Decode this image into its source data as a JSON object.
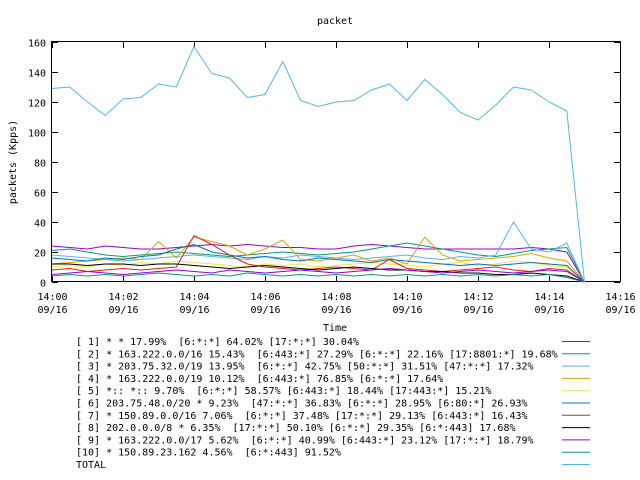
{
  "chart_data": {
    "type": "line",
    "title": "packet",
    "xlabel": "Time",
    "ylabel": "packets (Kpps)",
    "ylim": [
      0,
      160
    ],
    "xlim": [
      "14:00",
      "14:16"
    ],
    "grid": false,
    "legend_placement": "bottom",
    "y_ticks": [
      0,
      20,
      40,
      60,
      80,
      100,
      120,
      140,
      160
    ],
    "x_ticks": [
      {
        "time": "14:00",
        "date": "09/16"
      },
      {
        "time": "14:02",
        "date": "09/16"
      },
      {
        "time": "14:04",
        "date": "09/16"
      },
      {
        "time": "14:06",
        "date": "09/16"
      },
      {
        "time": "14:08",
        "date": "09/16"
      },
      {
        "time": "14:10",
        "date": "09/16"
      },
      {
        "time": "14:12",
        "date": "09/16"
      },
      {
        "time": "14:14",
        "date": "09/16"
      },
      {
        "time": "14:16",
        "date": "09/16"
      }
    ],
    "x": [
      "14:00:00",
      "14:00:30",
      "14:01:00",
      "14:01:30",
      "14:02:00",
      "14:02:30",
      "14:03:00",
      "14:03:30",
      "14:04:00",
      "14:04:30",
      "14:05:00",
      "14:05:30",
      "14:06:00",
      "14:06:30",
      "14:07:00",
      "14:07:30",
      "14:08:00",
      "14:08:30",
      "14:09:00",
      "14:09:30",
      "14:10:00",
      "14:10:30",
      "14:11:00",
      "14:11:30",
      "14:12:00",
      "14:12:30",
      "14:13:00",
      "14:13:30",
      "14:14:00",
      "14:14:30",
      "14:15:00"
    ],
    "series": [
      {
        "name": "[ 1] * * 17.99%  [6:*:*] 64.02% [17:*:*] 30.04%",
        "color": "#9400d3",
        "values": [
          24,
          23,
          22,
          24,
          23,
          22,
          22,
          23,
          24,
          25,
          24,
          25,
          24,
          23,
          23,
          22,
          22,
          24,
          25,
          24,
          23,
          22,
          22,
          22,
          22,
          22,
          22,
          23,
          22,
          20,
          0
        ]
      },
      {
        "name": "[ 2] * 163.222.0.0/16 15.43%  [6:443:*] 27.29% [6:*:*] 22.16% [17:8801:*] 19.68%",
        "color": "#009e73",
        "values": [
          21,
          22,
          20,
          18,
          17,
          18,
          19,
          20,
          19,
          18,
          17,
          18,
          19,
          20,
          19,
          18,
          19,
          20,
          22,
          24,
          26,
          24,
          22,
          20,
          18,
          17,
          19,
          21,
          22,
          23,
          0
        ]
      },
      {
        "name": "[ 3] * 203.75.32.0/19 13.95%  [6:*:*] 42.75% [50:*:*] 31.51% [47:*:*] 17.32%",
        "color": "#56b4e9",
        "values": [
          18,
          17,
          16,
          15,
          14,
          15,
          16,
          17,
          18,
          17,
          16,
          15,
          17,
          16,
          18,
          17,
          16,
          15,
          16,
          17,
          18,
          16,
          15,
          17,
          16,
          18,
          40,
          22,
          20,
          26,
          0
        ]
      },
      {
        "name": "[ 4] * 163.222.0.0/19 10.12%  [6:443:*] 76.85% [6:*:*] 17.64%",
        "color": "#e69f00",
        "values": [
          12,
          13,
          14,
          15,
          16,
          15,
          27,
          16,
          30,
          27,
          24,
          18,
          22,
          28,
          15,
          14,
          16,
          18,
          14,
          16,
          12,
          30,
          18,
          14,
          15,
          16,
          17,
          19,
          16,
          14,
          0
        ]
      },
      {
        "name": "[ 5] *:: *:: 9.70%  [6:*:*] 58.57% [6:443:*] 18.44% [17:443:*] 15.21%",
        "color": "#f0e442",
        "values": [
          10,
          11,
          10,
          12,
          11,
          13,
          12,
          14,
          13,
          12,
          11,
          10,
          12,
          11,
          12,
          10,
          11,
          12,
          13,
          12,
          11,
          10,
          12,
          13,
          11,
          12,
          14,
          13,
          11,
          10,
          0
        ]
      },
      {
        "name": "[ 6] 203.75.48.0/20 * 9.23%  [47:*:*] 36.83% [6:*:*] 28.95% [6:80:*] 26.93%",
        "color": "#0072b2",
        "values": [
          16,
          15,
          14,
          16,
          15,
          17,
          18,
          22,
          25,
          20,
          18,
          16,
          17,
          15,
          14,
          16,
          15,
          14,
          13,
          15,
          14,
          13,
          12,
          11,
          12,
          11,
          12,
          13,
          12,
          11,
          0
        ]
      },
      {
        "name": "[ 7] * 150.89.0.0/16 7.06%  [6:*:*] 37.48% [17:*:*] 29.13% [6:443:*] 16.43%",
        "color": "#e51e10",
        "values": [
          8,
          9,
          7,
          8,
          9,
          8,
          9,
          10,
          31,
          25,
          18,
          12,
          10,
          9,
          8,
          9,
          10,
          9,
          8,
          15,
          9,
          8,
          7,
          8,
          9,
          10,
          8,
          7,
          9,
          8,
          0
        ]
      },
      {
        "name": "[ 8] 202.0.0.0/8 * 6.35%  [17:*:*] 50.10% [6:*:*] 29.35% [6:*:443] 17.68%",
        "color": "#000000",
        "values": [
          12,
          12,
          11,
          12,
          12,
          11,
          12,
          12,
          11,
          10,
          9,
          10,
          11,
          10,
          9,
          8,
          9,
          10,
          9,
          8,
          8,
          7,
          7,
          6,
          6,
          5,
          5,
          6,
          5,
          4,
          0
        ]
      },
      {
        "name": "[ 9] * 163.222.0.0/17 5.62%  [6:*:*] 40.99% [6:443:*] 23.12% [17:*:*] 18.79%",
        "color": "#9400d3",
        "values": [
          5,
          6,
          7,
          6,
          5,
          6,
          7,
          8,
          7,
          6,
          8,
          7,
          6,
          7,
          8,
          7,
          6,
          7,
          8,
          9,
          8,
          7,
          6,
          7,
          8,
          7,
          6,
          7,
          8,
          7,
          0
        ]
      },
      {
        "name": "[10] * 150.89.23.162 4.56%  [6:*:443] 91.52%",
        "color": "#009e73",
        "values": [
          4,
          5,
          4,
          5,
          4,
          5,
          6,
          5,
          4,
          5,
          4,
          6,
          5,
          4,
          5,
          4,
          5,
          4,
          5,
          4,
          5,
          4,
          5,
          4,
          5,
          4,
          5,
          4,
          5,
          3,
          0
        ]
      },
      {
        "name": "TOTAL",
        "color": "#56b4e9",
        "values": [
          129,
          130,
          120,
          111,
          122,
          123,
          132,
          130,
          157,
          139,
          136,
          123,
          125,
          147,
          121,
          117,
          120,
          121,
          128,
          132,
          121,
          135,
          125,
          113,
          108,
          118,
          130,
          128,
          120,
          114,
          0
        ]
      }
    ]
  }
}
